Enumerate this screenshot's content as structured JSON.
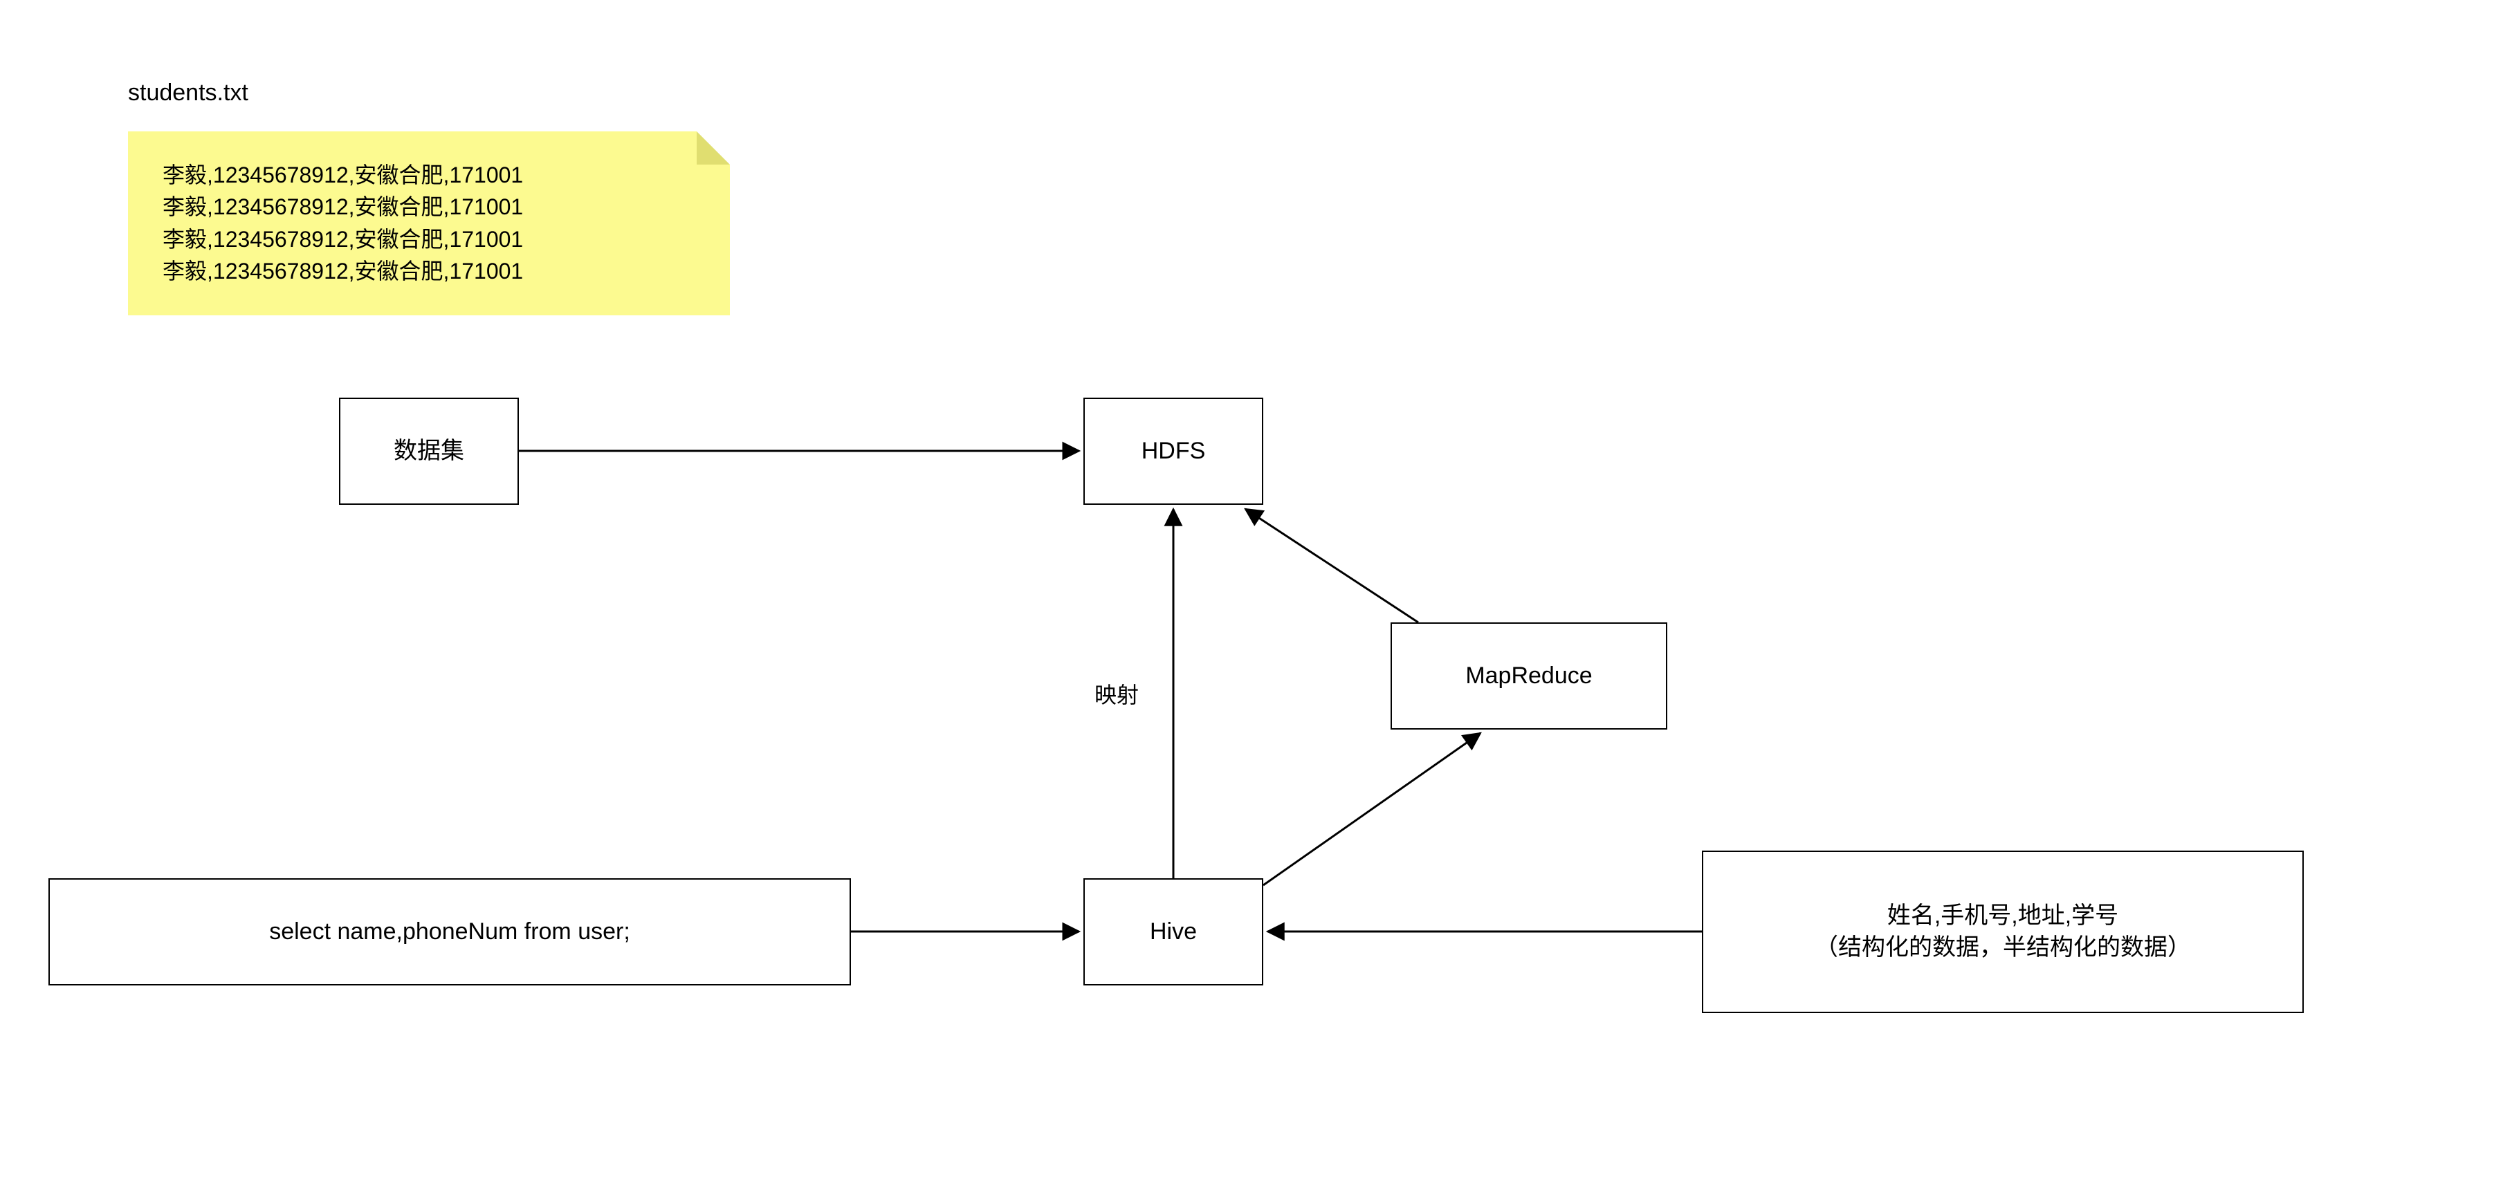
{
  "title": "students.txt",
  "note_lines": [
    "李毅,12345678912,安徽合肥,171001",
    "李毅,12345678912,安徽合肥,171001",
    "李毅,12345678912,安徽合肥,171001",
    "李毅,12345678912,安徽合肥,171001"
  ],
  "nodes": {
    "dataset": "数据集",
    "hdfs": "HDFS",
    "mapreduce": "MapReduce",
    "hive": "Hive",
    "query": "select name,phoneNum from user;",
    "schema_line1": "姓名,手机号,地址,学号",
    "schema_line2": "（结构化的数据，半结构化的数据）"
  },
  "edge_labels": {
    "mapping": "映射"
  }
}
